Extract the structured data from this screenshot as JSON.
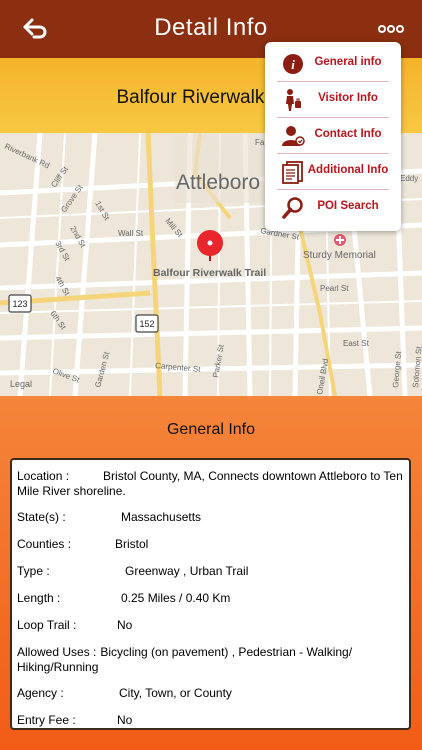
{
  "header": {
    "title": "Detail Info",
    "back_icon": "back-arrow-icon",
    "more_icon": "more-dots-icon"
  },
  "place_name": "Balfour Riverwalk Trail",
  "map": {
    "city_label": "Attleboro",
    "pin_label": "Balfour Riverwalk Trail",
    "hospital_label": "Sturdy Memorial",
    "legal_label": "Legal",
    "route_shields": [
      "123",
      "152"
    ],
    "streets": [
      "Riverbank Rd",
      "Cliff St",
      "Grove St",
      "1st St",
      "2nd St",
      "3rd St",
      "4th St",
      "6th St",
      "Wall St",
      "Mill St",
      "Gardner St",
      "Pearl St",
      "East St",
      "Carpenter St",
      "Parker St",
      "Olive St",
      "Garden St",
      "Oneil Blvd",
      "George St",
      "Solomon St",
      "Eddy",
      "Fa"
    ]
  },
  "menu": {
    "items": [
      {
        "label": "General info",
        "icon": "info-icon"
      },
      {
        "label": "Visitor Info",
        "icon": "visitor-icon"
      },
      {
        "label": "Contact Info",
        "icon": "contact-icon"
      },
      {
        "label": "Additional Info",
        "icon": "document-icon"
      },
      {
        "label": "POI Search",
        "icon": "search-icon"
      }
    ]
  },
  "general": {
    "title": "General Info",
    "rows": [
      {
        "label": "Location  :",
        "value": "Bristol County, MA, Connects downtown Attleboro to Ten Mile River shoreline."
      },
      {
        "label": "State(s)  :",
        "value": "Massachusetts"
      },
      {
        "label": "Counties  :",
        "value": "Bristol"
      },
      {
        "label": "Type  :",
        "value": "Greenway , Urban Trail"
      },
      {
        "label": "Length  :",
        "value": "0.25 Miles / 0.40 Km"
      },
      {
        "label": "Loop Trail  :",
        "value": "No"
      },
      {
        "label": "Allowed Uses  :",
        "value": "Bicycling (on pavement) , Pedestrian - Walking/ Hiking/Running"
      },
      {
        "label": "Agency  :",
        "value": "City, Town, or County"
      },
      {
        "label": "Entry Fee  :",
        "value": "No"
      }
    ]
  },
  "colors": {
    "header": "#8b2f10",
    "band": "#f6be36",
    "orange": "#f4853a",
    "menu_text": "#b9151d",
    "pin": "#e8262b"
  }
}
